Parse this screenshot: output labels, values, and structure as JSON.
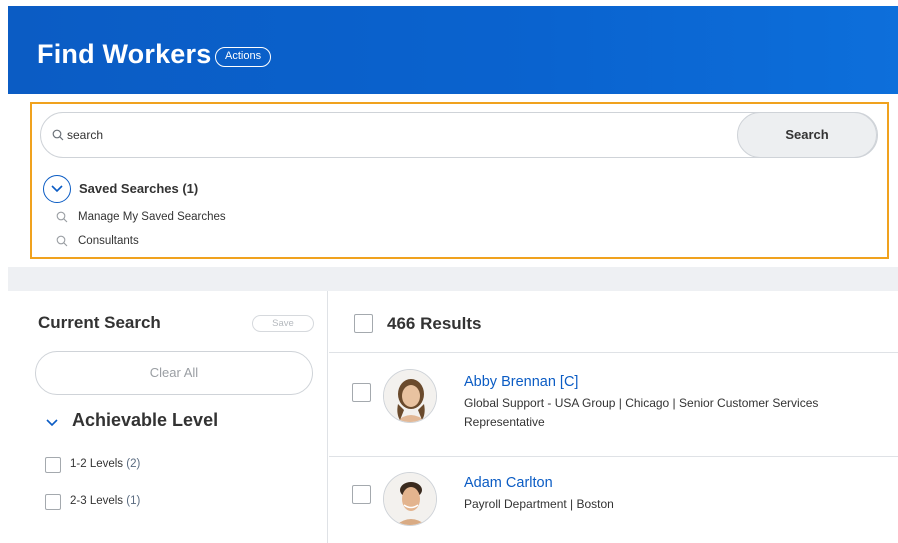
{
  "header": {
    "title": "Find Workers",
    "actions_label": "Actions",
    "color": "#0b5cc4"
  },
  "search": {
    "value": "search",
    "button_label": "Search",
    "highlight_color": "#f0a21e"
  },
  "saved_searches": {
    "title": "Saved Searches (1)",
    "items": [
      {
        "label": "Manage My Saved Searches",
        "icon": "search-icon"
      },
      {
        "label": "Consultants",
        "icon": "search-icon"
      }
    ]
  },
  "current_search": {
    "title": "Current Search",
    "save_label": "Save",
    "clear_all_label": "Clear All",
    "facet": {
      "title": "Achievable Level",
      "options": [
        {
          "label": "1-2 Levels",
          "count": "(2)"
        },
        {
          "label": "2-3 Levels",
          "count": "(1)"
        }
      ]
    }
  },
  "results": {
    "count_label": "466 Results",
    "items": [
      {
        "name": "Abby Brennan [C]",
        "description": "Global Support - USA Group | Chicago | Senior Customer Services Representative",
        "avatar": "female-avatar"
      },
      {
        "name": "Adam Carlton",
        "description": "Payroll Department | Boston",
        "avatar": "male-avatar"
      }
    ]
  }
}
